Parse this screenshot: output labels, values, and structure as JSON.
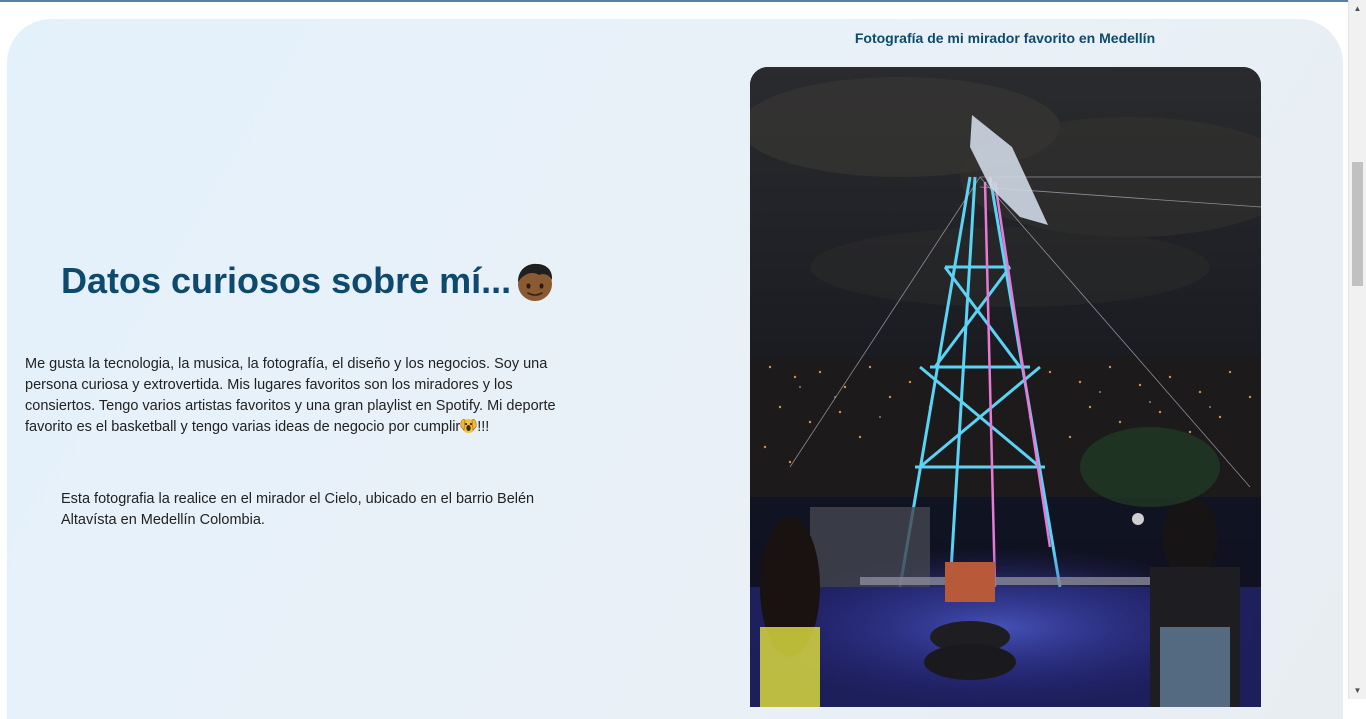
{
  "section": {
    "photo_caption": "Fotografía de mi mirador favorito en Medellín",
    "heading": "Datos curiosos sobre mí...",
    "heading_emoji": "boy-face-icon",
    "paragraph1": "Me gusta la tecnologia, la musica, la fotografía, el diseño y los negocios. Soy una persona curiosa y extrovertida. Mis lugares favoritos son los miradores y los consiertos. Tengo varios artistas favoritos y una gran playlist en Spotify. Mi deporte favorito es el basketball y tengo varias ideas de negocio por cumplir",
    "paragraph1_emoji": "screaming-face-icon",
    "paragraph1_suffix": "!!!",
    "paragraph2": "Esta fotografia la realice en el mirador el Cielo, ubicado en el barrio Belén Altavísta en Medellín Colombia.",
    "photo_alt": "Mirador el Cielo, Medellín de noche"
  },
  "colors": {
    "heading": "#0d4a6e",
    "body_text": "#222222",
    "card_background": "#e6f0f8"
  }
}
